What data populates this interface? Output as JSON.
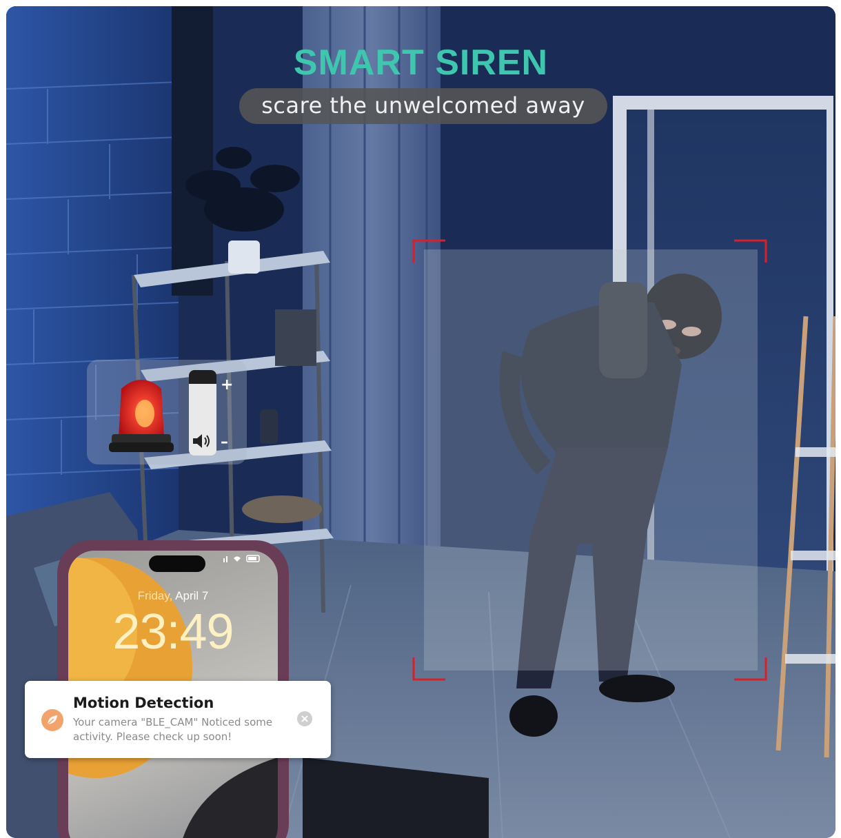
{
  "header": {
    "title": "SMART SIREN",
    "subtitle": "scare the unwelcomed away"
  },
  "siren_widget": {
    "siren_icon": "siren-light-icon",
    "volume_plus": "+",
    "volume_minus": "–",
    "speaker_icon": "speaker-icon"
  },
  "phone": {
    "date_day": "Friday,",
    "date_rest": " April 7",
    "time": "23:49"
  },
  "notification": {
    "title": "Motion Detection",
    "body": "Your camera \"BLE_CAM\" Noticed some activity. Please check up soon!",
    "app_icon": "leaf-icon",
    "close_icon": "close-icon"
  },
  "colors": {
    "accent_teal": "#3ec6ae",
    "detection_corner": "#d8202a",
    "night_blue": "#1c2f58"
  }
}
